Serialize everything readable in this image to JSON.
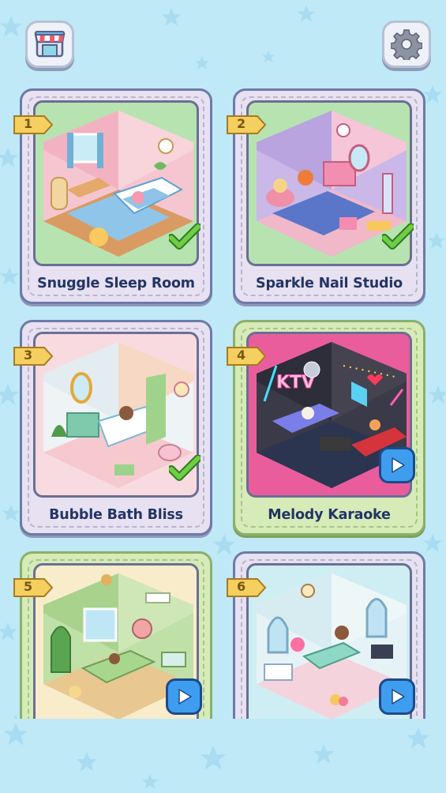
{
  "header": {
    "shop_icon": "shop-icon",
    "settings_icon": "gear-icon"
  },
  "levels": [
    {
      "number": "1",
      "title": "Snuggle Sleep Room",
      "status": "completed"
    },
    {
      "number": "2",
      "title": "Sparkle Nail Studio",
      "status": "completed"
    },
    {
      "number": "3",
      "title": "Bubble Bath Bliss",
      "status": "completed"
    },
    {
      "number": "4",
      "title": "Melody Karaoke",
      "status": "video-unlock"
    },
    {
      "number": "5",
      "title": "",
      "status": "video-unlock"
    },
    {
      "number": "6",
      "title": "",
      "status": "video-unlock"
    }
  ],
  "art_labels": {
    "karaoke_sign": "KTV"
  },
  "colors": {
    "background": "#bfe9f7",
    "card_purple": "#e7e1f2",
    "card_green": "#d6ebb8",
    "title_text": "#233565",
    "check_green": "#5fbf3a",
    "play_blue": "#3f9df0"
  }
}
